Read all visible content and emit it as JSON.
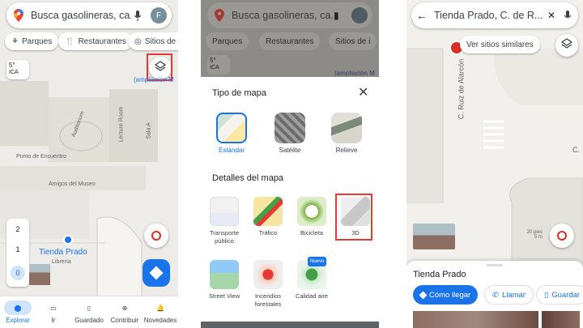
{
  "colors": {
    "accent": "#1a73e8",
    "highlight": "#e53935"
  },
  "panel1": {
    "search_placeholder": "Busca gasolineras, ca...",
    "avatar_letter": "F",
    "chips": [
      "Parques",
      "Restaurantes",
      "Sitios de i"
    ],
    "weather_temp": "5°",
    "weather_label": "ICA",
    "map_labels": {
      "amplia": "(ampliación M",
      "auditorium": "Auditorium",
      "lecture_room": "Lecture Room",
      "sala_a": "Sala A",
      "punto_encuentro": "Punto de Encuentro",
      "amigos": "Amigos del Museo",
      "place_name": "Tienda Prado",
      "place_sub": "Librería"
    },
    "floors": [
      "2",
      "1",
      "0"
    ],
    "nav": [
      {
        "label": "Explorar",
        "icon": "location-pin-icon"
      },
      {
        "label": "Ir",
        "icon": "car-icon"
      },
      {
        "label": "Guardado",
        "icon": "bookmark-icon"
      },
      {
        "label": "Contribuir",
        "icon": "add-circle-icon"
      },
      {
        "label": "Novedades",
        "icon": "bell-icon"
      }
    ]
  },
  "panel2": {
    "search_placeholder": "Busca gasolineras, ca...",
    "chips": [
      "Parques",
      "Restaurantes",
      "Sitios de i"
    ],
    "weather_temp": "5°",
    "weather_label": "ICA",
    "amplia": "(ampliación M",
    "sheet_title": "Tipo de mapa",
    "map_types": [
      {
        "label": "Estándar",
        "selected": true
      },
      {
        "label": "Satélite",
        "selected": false
      },
      {
        "label": "Relieve",
        "selected": false
      }
    ],
    "details_title": "Detalles del mapa",
    "details": [
      {
        "label": "Transporte público"
      },
      {
        "label": "Tráfico"
      },
      {
        "label": "Bicicleta"
      },
      {
        "label": "3D"
      },
      {
        "label": "Street View"
      },
      {
        "label": "Incendios forestales"
      },
      {
        "label": "Calidad aire",
        "badge": "Nuevo"
      }
    ]
  },
  "panel3": {
    "search_text": "Tienda Prado, C. de R...",
    "similar_button": "Ver sitios similares",
    "street_label": "C. Ruiz de Alarcón",
    "street_right": "C.",
    "scale_feet": "20 pies",
    "scale_meters": "5 m",
    "place_title": "Tienda Prado",
    "actions": [
      "Cómo llegar",
      "Llamar",
      "Guardar"
    ]
  }
}
